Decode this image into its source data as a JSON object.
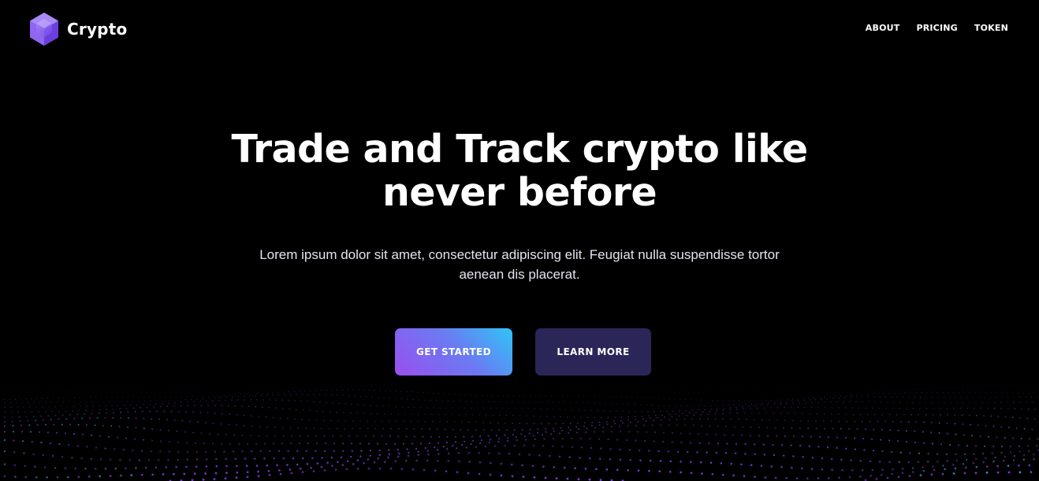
{
  "brand": {
    "name": "Crypto",
    "logo_icon": "hexagon-cube-icon",
    "accent_color": "#8b5cf6"
  },
  "nav": {
    "items": [
      {
        "label": "ABOUT"
      },
      {
        "label": "PRICING"
      },
      {
        "label": "TOKEN"
      }
    ]
  },
  "hero": {
    "title_line1": "Trade and Track crypto like",
    "title_line2": "never before",
    "subtitle_line1": "Lorem ipsum dolor sit amet, consectetur adipiscing elit. Feugiat nulla suspendisse tortor",
    "subtitle_line2": "aenean dis placerat.",
    "primary_button": "GET STARTED",
    "secondary_button": "LEARN MORE"
  },
  "colors": {
    "background": "#000000",
    "primary_gradient_start": "#9a4ff0",
    "primary_gradient_end": "#2fc6f6",
    "secondary_button": "#2b2658",
    "dot_wave_primary": "#8a3ff0",
    "dot_wave_secondary": "#3fa0e8"
  }
}
